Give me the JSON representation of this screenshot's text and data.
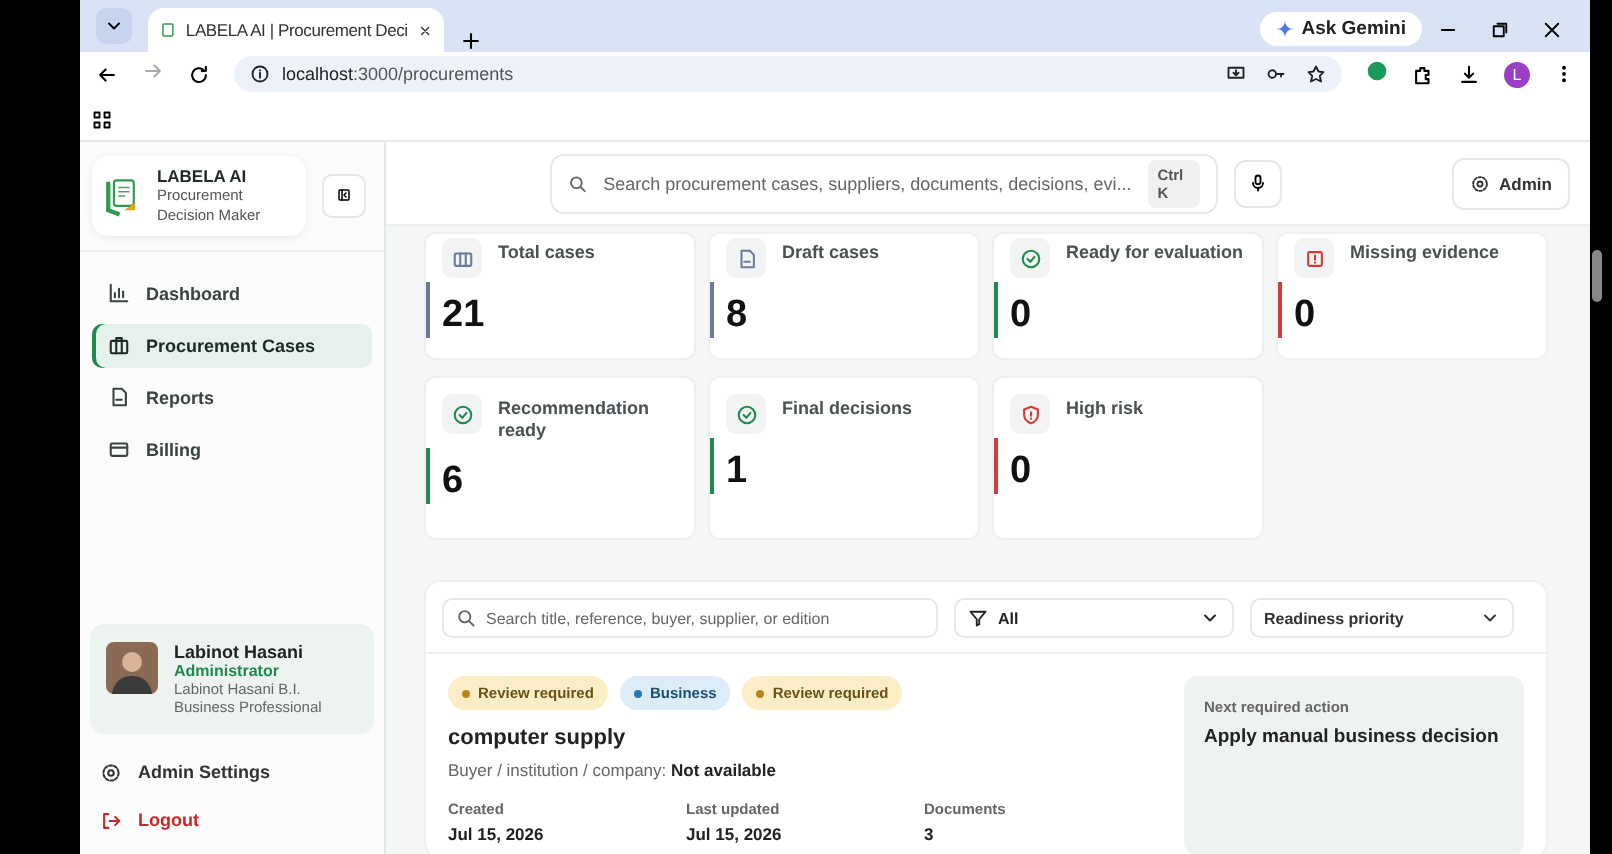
{
  "browser": {
    "tab_title": "LABELA AI | Procurement Deci",
    "ask_button": "Ask Gemini",
    "url_host": "localhost",
    "url_path": ":3000/procurements",
    "profile": "L"
  },
  "sidebar": {
    "brand": "LABELA AI",
    "brand_sub": "Procurement Decision Maker",
    "items": [
      {
        "label": "Dashboard",
        "selected": false
      },
      {
        "label": "Procurement Cases",
        "selected": true
      },
      {
        "label": "Reports",
        "selected": false
      },
      {
        "label": "Billing",
        "selected": false
      }
    ],
    "user": {
      "name": "Labinot Hasani",
      "role": "Administrator",
      "org": "Labinot Hasani B.I.",
      "title": "Business Professional"
    },
    "footer": [
      {
        "label": "Admin Settings",
        "kind": "settings"
      },
      {
        "label": "Logout",
        "kind": "logout"
      }
    ]
  },
  "header": {
    "search_placeholder": "Search procurement cases, suppliers, documents, decisions, evi...",
    "shortcut": "Ctrl K",
    "admin": "Admin"
  },
  "stats": [
    {
      "label": "Total cases",
      "value": "21",
      "color": "#6b7a99"
    },
    {
      "label": "Draft cases",
      "value": "8",
      "color": "#6b7a99"
    },
    {
      "label": "Ready for evaluation",
      "value": "0",
      "color": "#1f8a4c"
    },
    {
      "label": "Missing evidence",
      "value": "0",
      "color": "#d33a3a"
    },
    {
      "label": "Recommendation ready",
      "value": "6",
      "color": "#1f8a4c"
    },
    {
      "label": "Final decisions",
      "value": "1",
      "color": "#1f8a4c"
    },
    {
      "label": "High risk",
      "value": "0",
      "color": "#d33a3a"
    }
  ],
  "filters": {
    "search_placeholder": "Search title, reference, buyer, supplier, or edition",
    "status": "All",
    "sort": "Readiness priority"
  },
  "case": {
    "tags": [
      {
        "label": "Review required",
        "kind": "warning"
      },
      {
        "label": "Business",
        "kind": "info"
      },
      {
        "label": "Review required",
        "kind": "warning"
      }
    ],
    "title": "computer supply",
    "buyer_label": "Buyer / institution / company:",
    "buyer_value": "Not available",
    "meta": [
      {
        "label": "Created",
        "value": "Jul 15, 2026"
      },
      {
        "label": "Last updated",
        "value": "Jul 15, 2026"
      },
      {
        "label": "Documents",
        "value": "3"
      }
    ],
    "next_label": "Next required action",
    "next_value": "Apply manual business decision"
  }
}
